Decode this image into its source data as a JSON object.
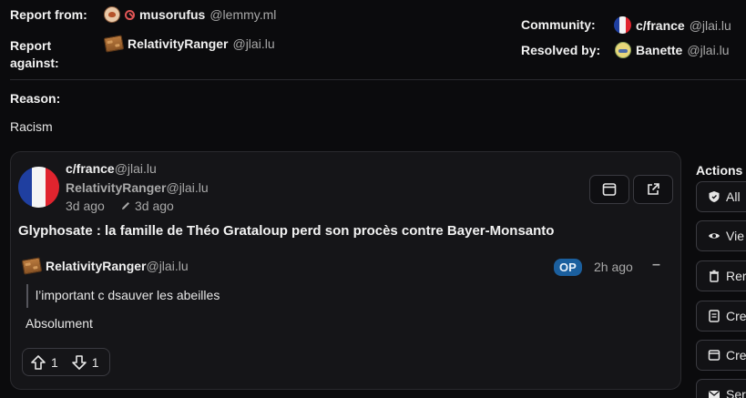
{
  "report": {
    "from_label": "Report from:",
    "from_user": {
      "name": "musorufus",
      "instance": "@lemmy.ml"
    },
    "against_label_1": "Report",
    "against_label_2": "against:",
    "against_user": {
      "name": "RelativityRanger",
      "instance": "@jlai.lu"
    },
    "community_label": "Community:",
    "community": {
      "name": "c/france",
      "instance": "@jlai.lu"
    },
    "resolved_label": "Resolved by:",
    "resolved_user": {
      "name": "Banette",
      "instance": "@jlai.lu"
    },
    "reason_label": "Reason:",
    "reason": "Racism"
  },
  "post": {
    "community": {
      "name": "c/france",
      "instance": "@jlai.lu"
    },
    "author": {
      "name": "RelativityRanger",
      "instance": "@jlai.lu"
    },
    "posted": "3d ago",
    "edited": "3d ago",
    "title": "Glyphosate : la famille de Théo Grataloup perd son procès contre Bayer-Monsanto"
  },
  "comment": {
    "author": {
      "name": "RelativityRanger",
      "instance": "@jlai.lu"
    },
    "badge": "OP",
    "time": "2h ago",
    "collapse": "–",
    "quote": "l’important c dsauver les abeilles",
    "body": "Absolument",
    "upvotes": "1",
    "downvotes": "1"
  },
  "actions": {
    "heading": "Actions",
    "items": [
      {
        "label": "All",
        "icon": "shield-icon"
      },
      {
        "label": "Vie",
        "icon": "eye-icon"
      },
      {
        "label": "Rer",
        "icon": "trash-icon"
      },
      {
        "label": "Cre",
        "icon": "document-icon"
      },
      {
        "label": "Cre",
        "icon": "window-icon"
      },
      {
        "label": "Ser",
        "icon": "mail-icon"
      }
    ]
  }
}
